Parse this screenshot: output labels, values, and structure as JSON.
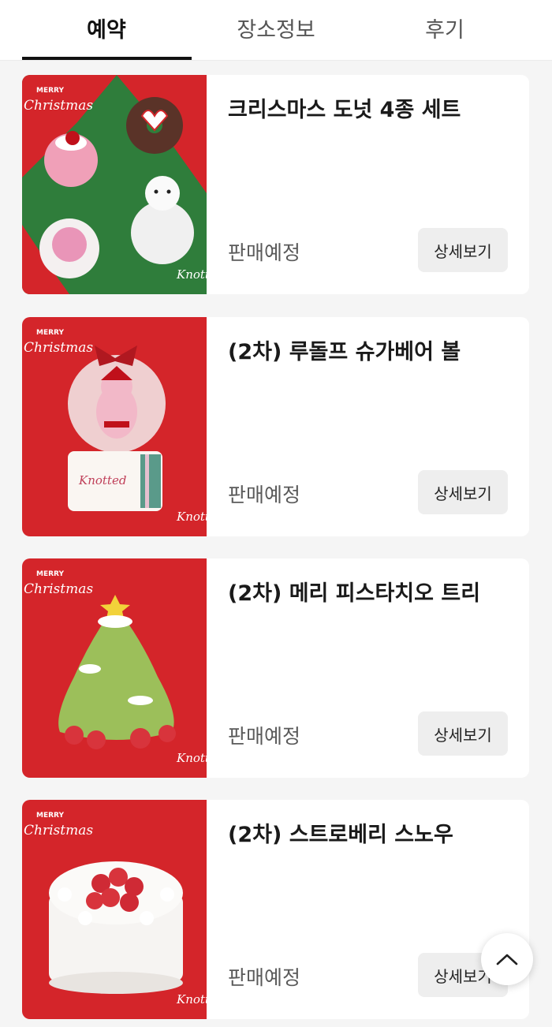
{
  "tabs": [
    {
      "label": "예약",
      "active": true
    },
    {
      "label": "장소정보",
      "active": false
    },
    {
      "label": "후기",
      "active": false
    }
  ],
  "products": [
    {
      "title": "크리스마스 도넛 4종 세트",
      "status": "판매예정",
      "button": "상세보기",
      "thumb_bg": "#d4252a",
      "thumb_accent": "#2e7d3a"
    },
    {
      "title": "(2차) 루돌프 슈가베어 볼",
      "status": "판매예정",
      "button": "상세보기",
      "thumb_bg": "#d4252a"
    },
    {
      "title": "(2차) 메리 피스타치오 트리",
      "status": "판매예정",
      "button": "상세보기",
      "thumb_bg": "#d4252a"
    },
    {
      "title": "(2차) 스트로베리 스노우",
      "status": "판매예정",
      "button": "상세보기",
      "thumb_bg": "#d4252a"
    }
  ],
  "thumb_text": {
    "merry": "MERRY",
    "christmas": "Christmas",
    "brand": "Knotted"
  },
  "icons": {
    "scroll_top": "chevron-up-icon"
  }
}
